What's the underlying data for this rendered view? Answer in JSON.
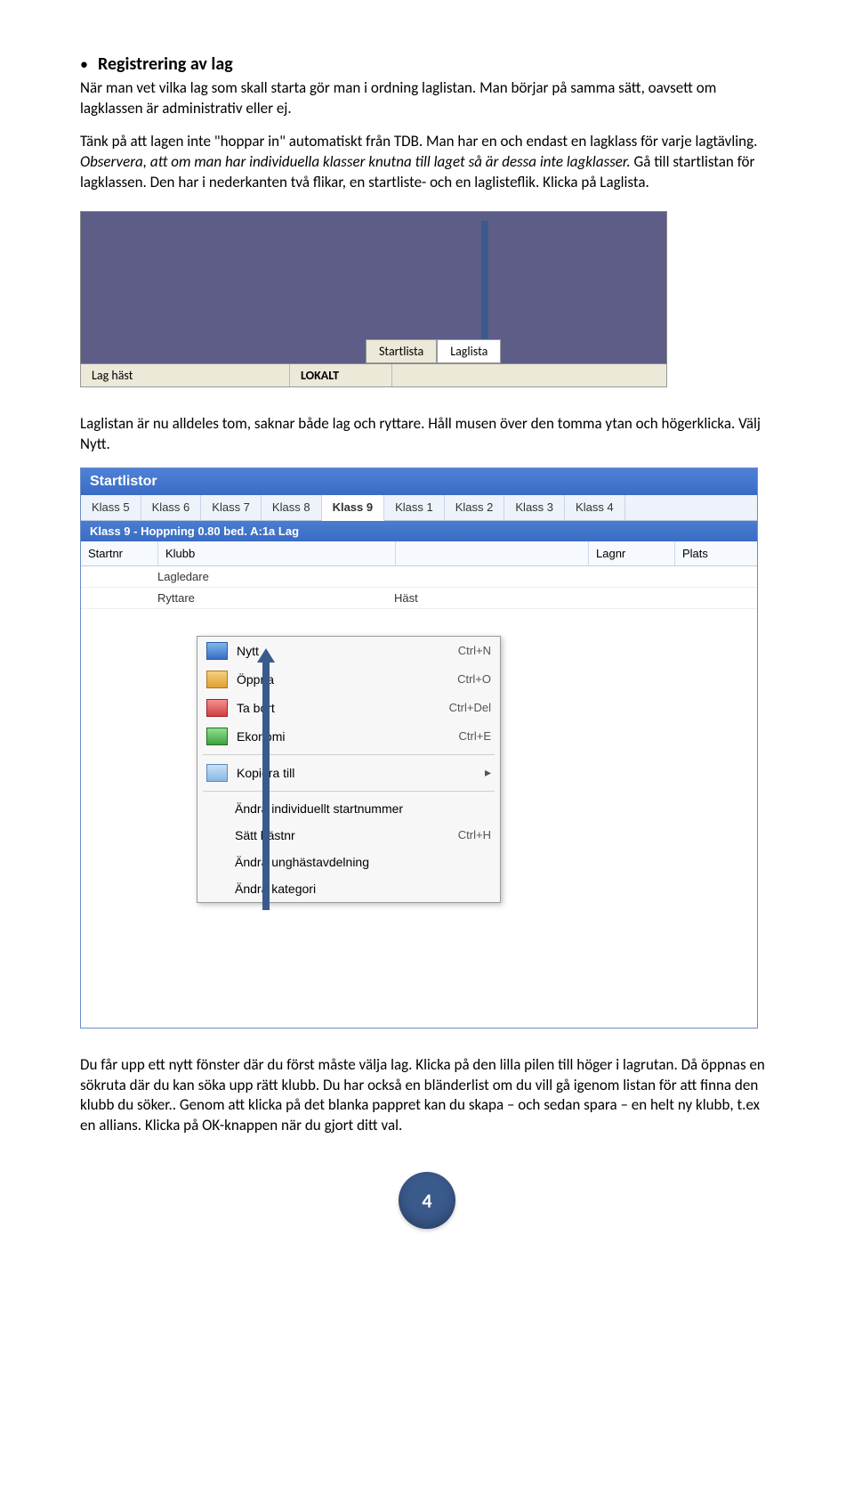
{
  "heading": "Registrering av lag",
  "para1": "När man vet vilka lag som skall starta gör man i ordning laglistan. Man börjar på samma sätt, oavsett om lagklassen är administrativ eller ej.",
  "para2a": "Tänk på att lagen inte \"hoppar in\" automatiskt från TDB. Man har en och endast en lagklass för varje lagtävling. ",
  "para2b": "Observera, att om man har individuella klasser knutna till laget så är dessa inte lagklasser.",
  "para2c": " Gå till startlistan för lagklassen. Den har i nederkanten två flikar, en startliste- och en laglisteflik. Klicka på Laglista.",
  "shot1": {
    "tab_startlista": "Startlista",
    "tab_laglista": "Laglista",
    "status_left": "Lag häst",
    "status_right": "LOKALT"
  },
  "para3": "Laglistan är nu alldeles tom, saknar både lag och ryttare. Håll musen över den tomma ytan och högerklicka. Välj Nytt.",
  "shot2": {
    "title": "Startlistor",
    "klass_labels": [
      "Klass 5",
      "Klass 6",
      "Klass 7",
      "Klass 8",
      "Klass 9",
      "Klass 1",
      "Klass 2",
      "Klass 3",
      "Klass 4"
    ],
    "active_klass_index": 4,
    "subhead": "Klass 9 - Hoppning 0.80 bed. A:1a Lag",
    "col_startnr": "Startnr",
    "col_klubb": "Klubb",
    "col_lagnr": "Lagnr",
    "col_plats": "Plats",
    "sub_lagledare": "Lagledare",
    "sub_ryttare": "Ryttare",
    "sub_hast": "Häst",
    "menu": [
      {
        "label": "Nytt",
        "shortcut": "Ctrl+N",
        "icon": "ic1"
      },
      {
        "label": "Öppna",
        "shortcut": "Ctrl+O",
        "icon": "ic2"
      },
      {
        "label": "Ta bort",
        "shortcut": "Ctrl+Del",
        "icon": "ic3"
      },
      {
        "label": "Ekonomi",
        "shortcut": "Ctrl+E",
        "icon": "ic4"
      },
      {
        "label": "Kopiera till",
        "shortcut": "",
        "icon": "ic5",
        "submenu": true
      },
      {
        "label": "Ändra individuellt startnummer",
        "shortcut": ""
      },
      {
        "label": "Sätt hästnr",
        "shortcut": "Ctrl+H"
      },
      {
        "label": "Ändra unghästavdelning",
        "shortcut": ""
      },
      {
        "label": "Ändra kategori",
        "shortcut": ""
      }
    ]
  },
  "para4": "Du får upp ett nytt fönster där du först måste välja lag. Klicka på den lilla pilen till höger i lagrutan. Då öppnas en sökruta där du kan söka upp rätt klubb. Du har också en bländerlist om du vill gå igenom listan för att finna den klubb du söker.. Genom att klicka på det blanka pappret kan du skapa – och sedan spara – en helt ny klubb, t.ex en allians. Klicka på OK-knappen när du gjort ditt val.",
  "page_number": "4"
}
